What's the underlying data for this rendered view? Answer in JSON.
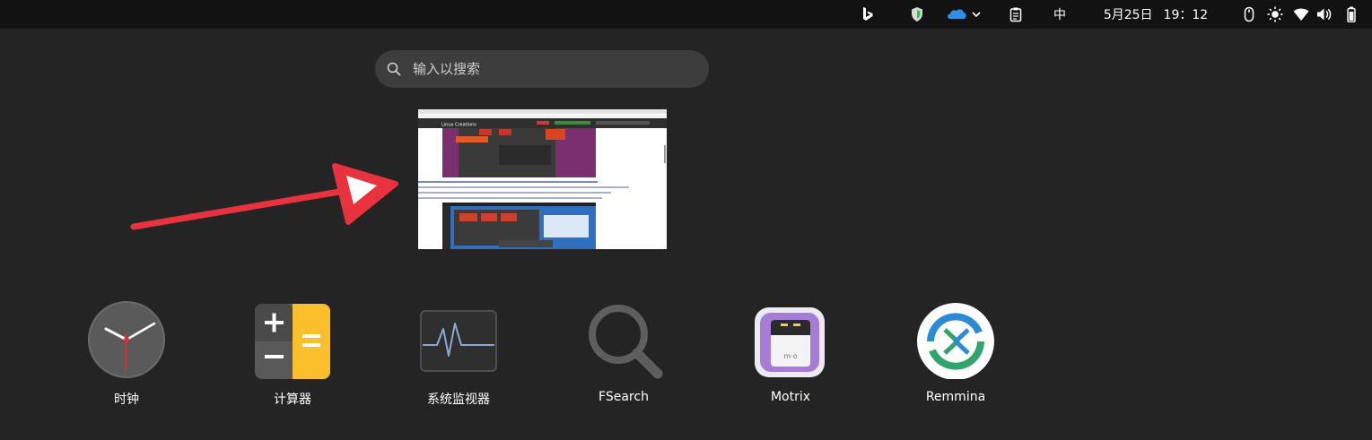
{
  "top_bar": {
    "input_method": "中",
    "date": "5月25日",
    "time": "19：12"
  },
  "search": {
    "placeholder": "输入以搜索"
  },
  "workspace": {
    "window_title": "Linux Creations"
  },
  "apps": [
    {
      "name": "时钟",
      "icon": "clock-icon"
    },
    {
      "name": "计算器",
      "icon": "calculator-icon"
    },
    {
      "name": "系统监视器",
      "icon": "system-monitor-icon"
    },
    {
      "name": "FSearch",
      "icon": "magnifier-icon"
    },
    {
      "name": "Motrix",
      "icon": "motrix-icon"
    },
    {
      "name": "Remmina",
      "icon": "remmina-icon"
    }
  ],
  "colors": {
    "background": "#242424",
    "top_bar": "#121212",
    "search_bg": "#3d3d3d",
    "arrow": "#e8333f",
    "calculator_yellow": "#fbbf2c",
    "remmina_blue": "#2b8ad6",
    "remmina_green": "#30a46c",
    "motrix_purple": "#a77bd8"
  }
}
